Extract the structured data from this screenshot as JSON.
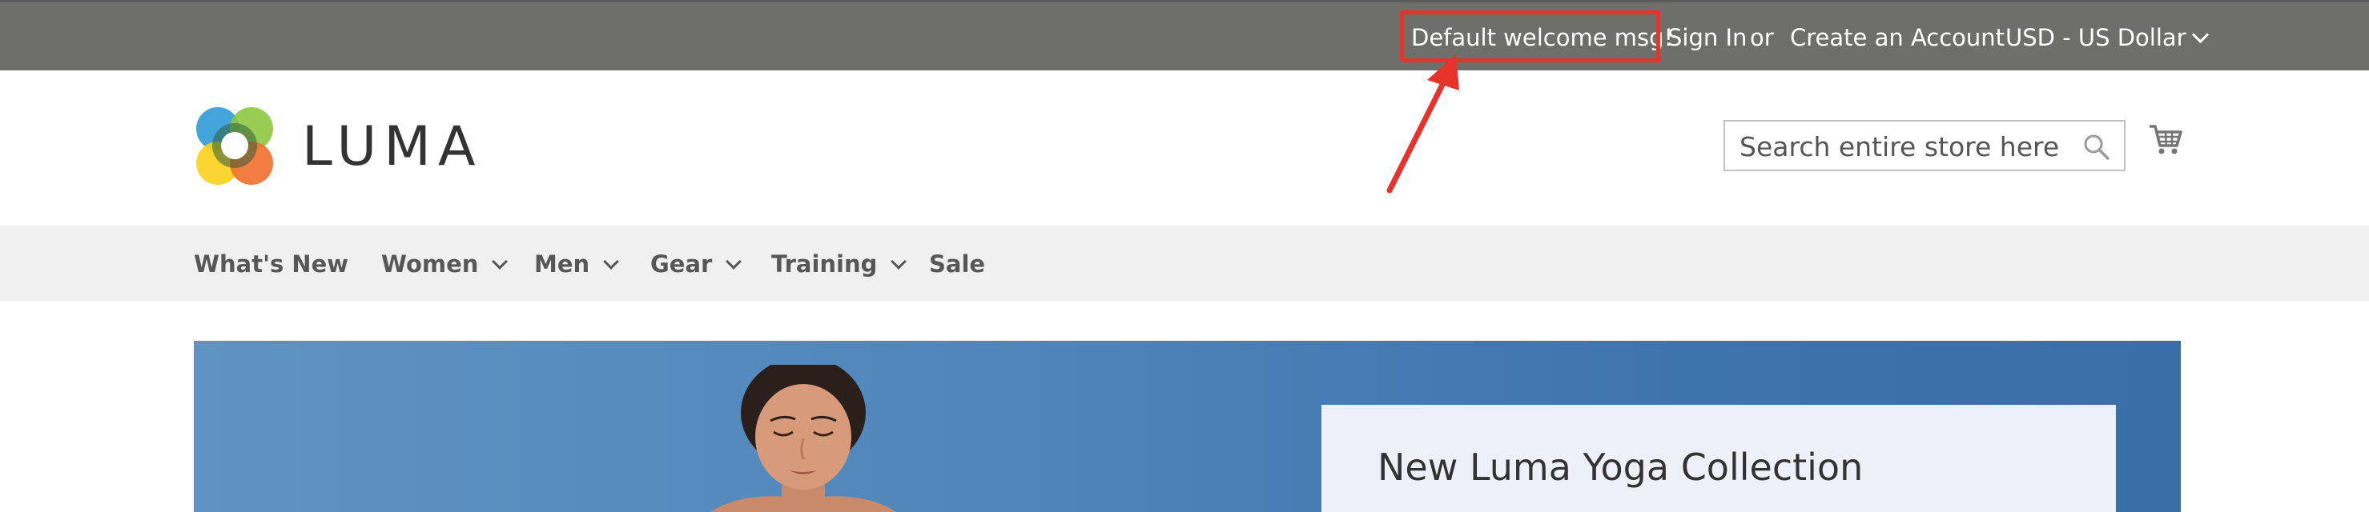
{
  "top_bar": {
    "welcome_message": "Default welcome msg!",
    "sign_in": "Sign In",
    "or_separator": "or",
    "create_account": "Create an Account",
    "currency": "USD - US Dollar"
  },
  "annotation": {
    "color": "#e8322c"
  },
  "header": {
    "logo_text": "LUMA",
    "search_placeholder": "Search entire store here...",
    "search_value": ""
  },
  "nav": {
    "items": [
      {
        "label": "What's New",
        "has_dropdown": false
      },
      {
        "label": "Women",
        "has_dropdown": true
      },
      {
        "label": "Men",
        "has_dropdown": true
      },
      {
        "label": "Gear",
        "has_dropdown": true
      },
      {
        "label": "Training",
        "has_dropdown": true
      },
      {
        "label": "Sale",
        "has_dropdown": false
      }
    ]
  },
  "hero": {
    "title": "New Luma Yoga Collection"
  },
  "icons": {
    "search": "search-icon",
    "cart": "cart-icon",
    "currency_chevron": "chevron-down-icon",
    "nav_chevron": "chevron-down-icon"
  },
  "colors": {
    "top_bar": "#6e6e6b",
    "nav_bg": "#f0f0f0",
    "highlight": "#e8322c",
    "logo_orange": "#f26f2c",
    "logo_green": "#8dc63f",
    "logo_blue": "#2d9ad7",
    "logo_yellow": "#f8d21b"
  }
}
